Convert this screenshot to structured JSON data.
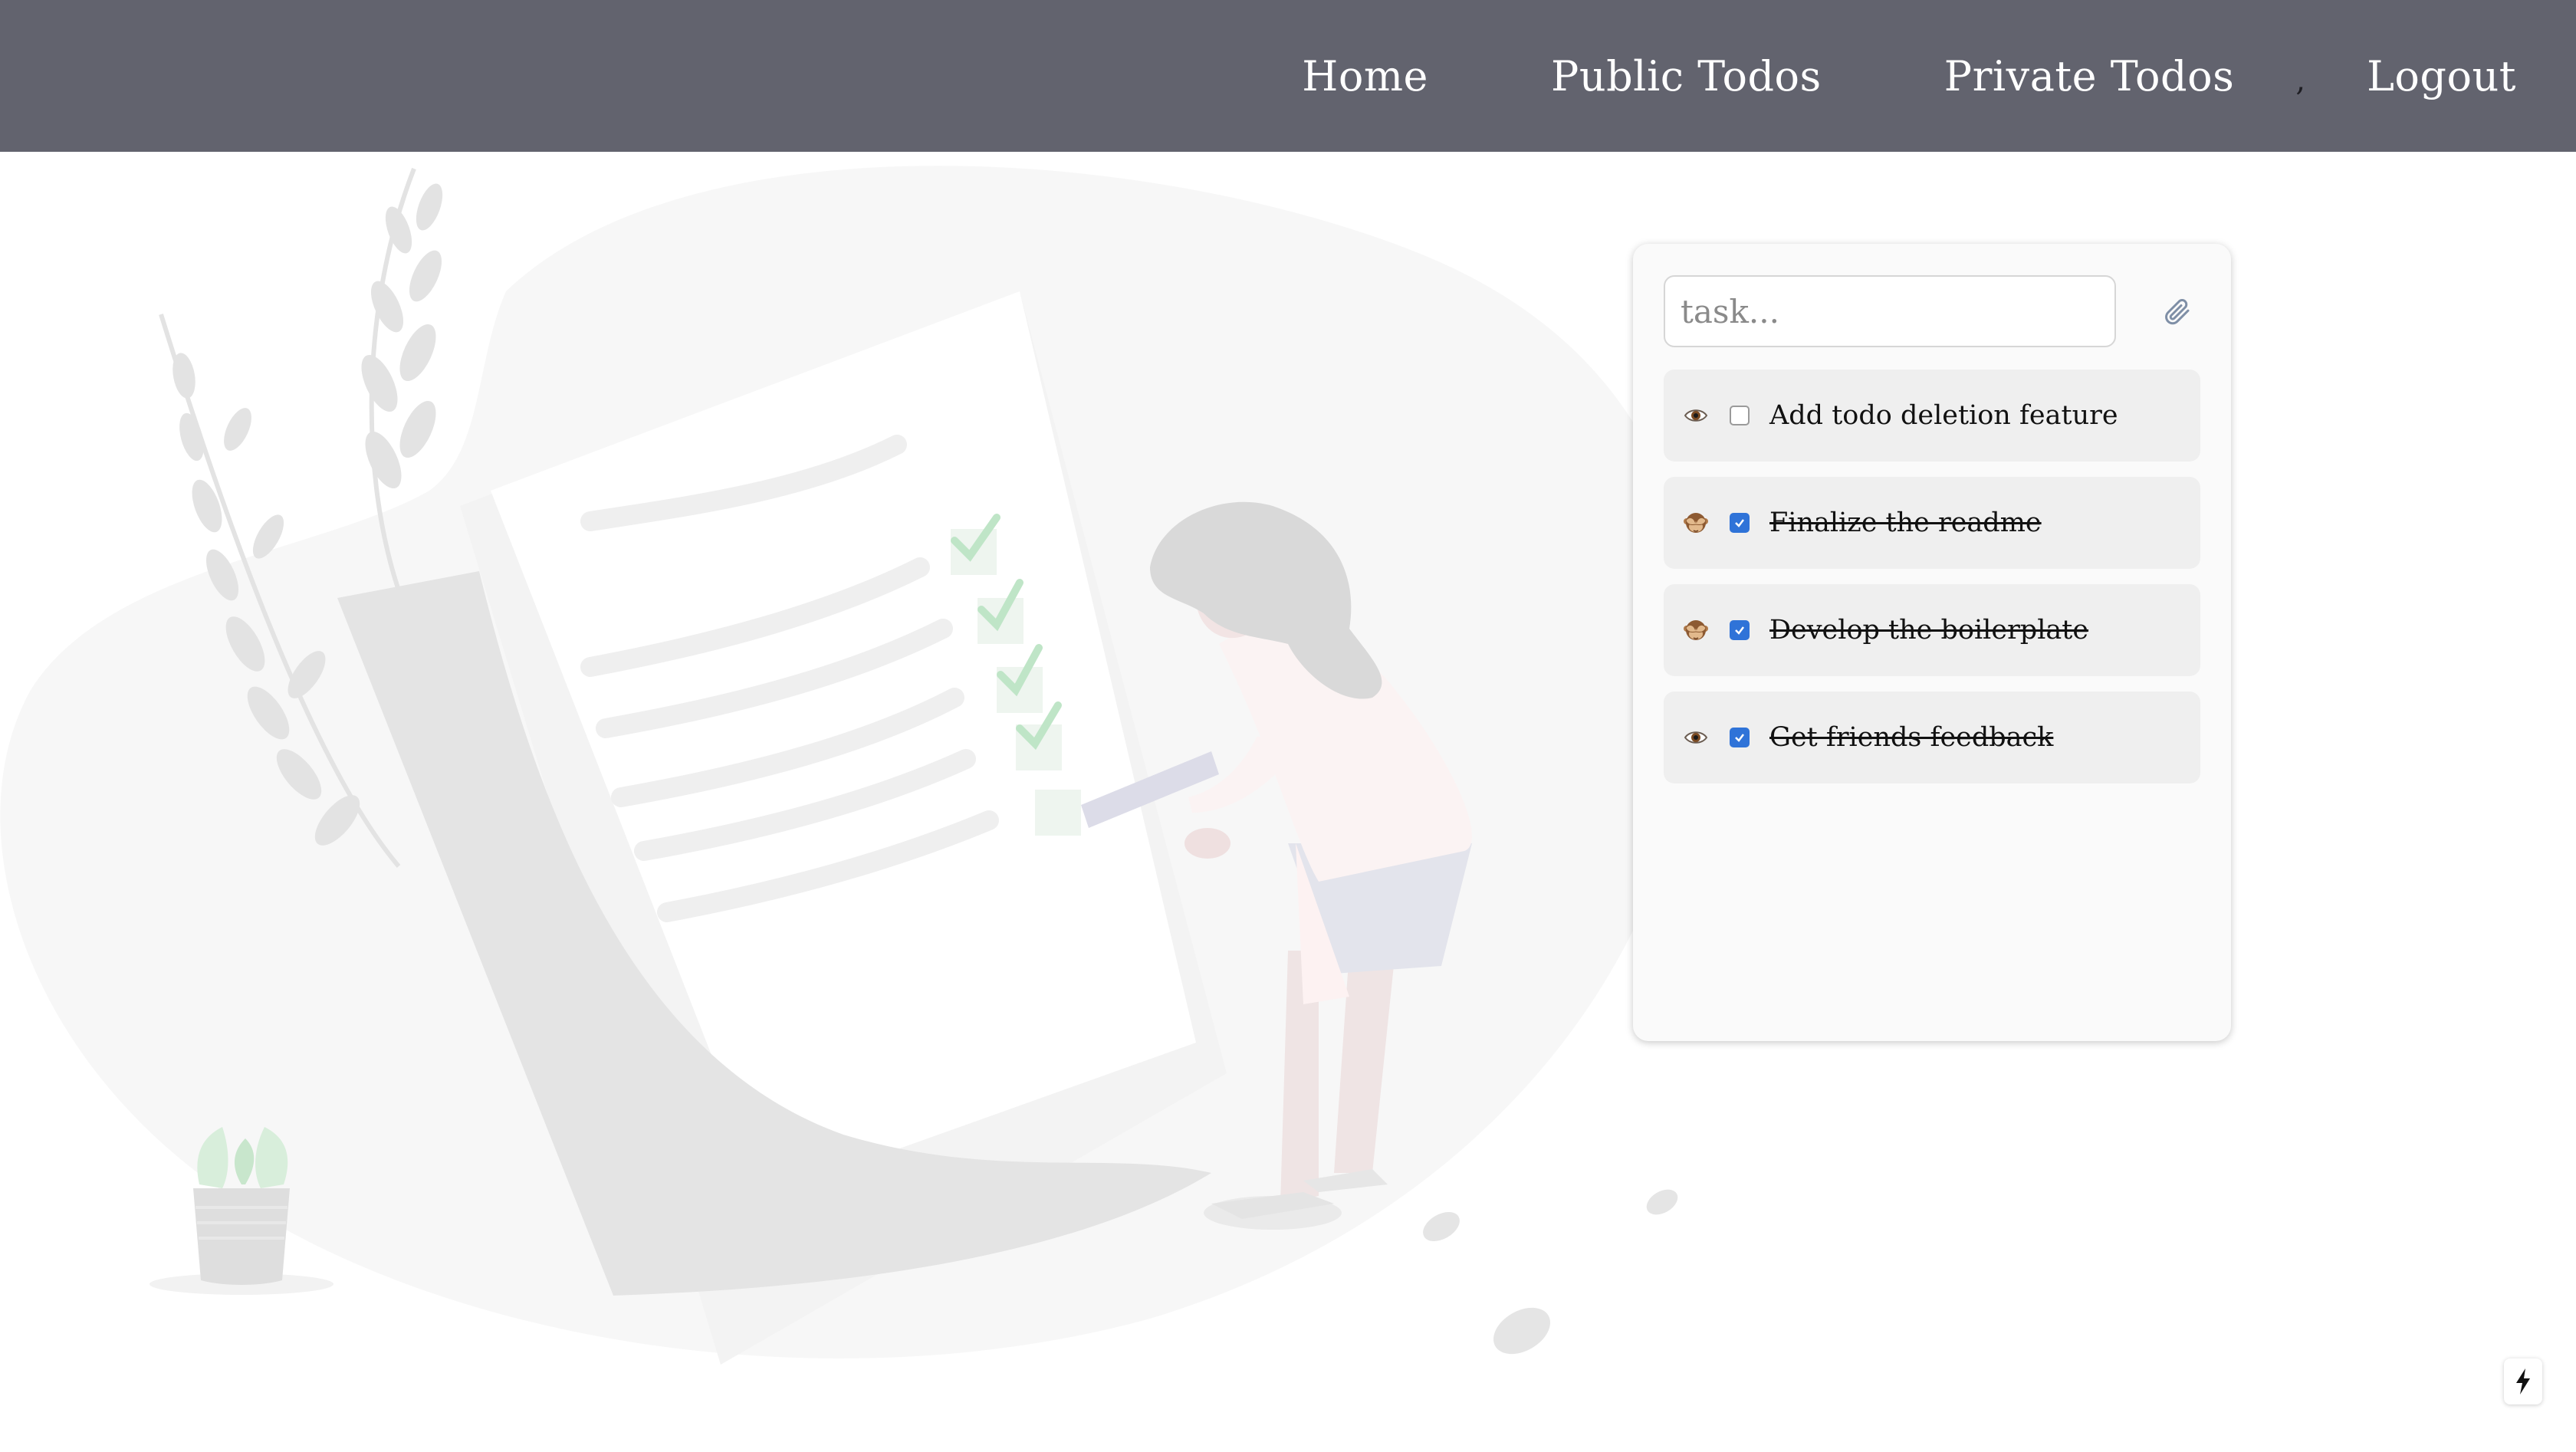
{
  "nav": {
    "links": [
      "Home",
      "Public Todos",
      "Private Todos"
    ],
    "separator": ",",
    "logout": "Logout"
  },
  "todo_form": {
    "placeholder": "task...",
    "attach_icon": "paperclip-icon"
  },
  "todos": [
    {
      "text": "Add todo deletion feature",
      "visibility": "public",
      "visibility_icon": "eye-icon",
      "completed": false
    },
    {
      "text": "Finalize the readme",
      "visibility": "private",
      "visibility_icon": "see-no-evil-monkey-icon",
      "completed": true
    },
    {
      "text": "Develop the boilerplate",
      "visibility": "private",
      "visibility_icon": "see-no-evil-monkey-icon",
      "completed": true
    },
    {
      "text": "Get friends feedback",
      "visibility": "public",
      "visibility_icon": "eye-icon",
      "completed": true
    }
  ],
  "badge": {
    "icon": "lightning-bolt-icon"
  },
  "colors": {
    "navbar": "#62636e",
    "card": "#fafafa",
    "todo_item": "#efefef",
    "checkbox_checked": "#2f73d8"
  }
}
